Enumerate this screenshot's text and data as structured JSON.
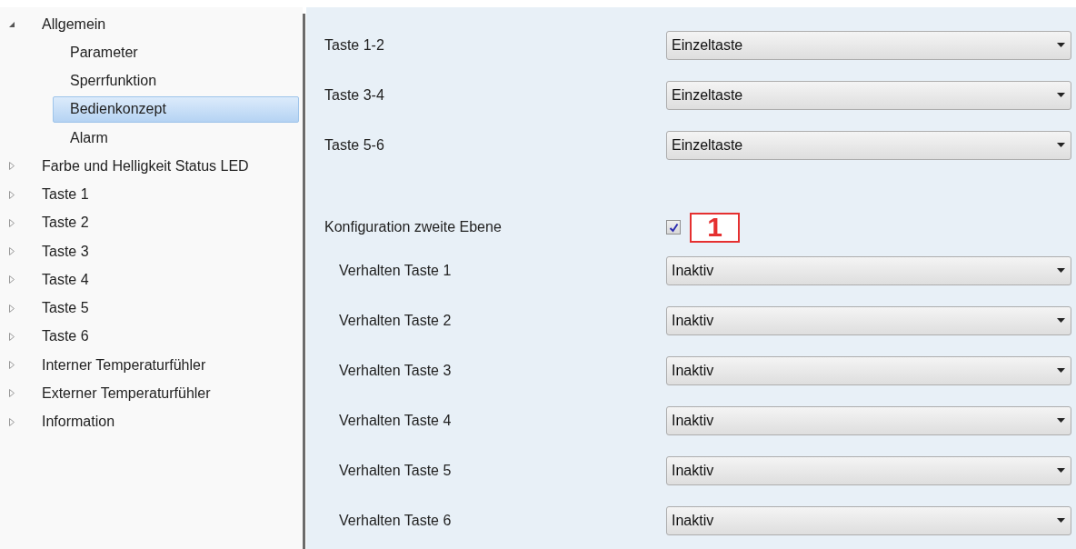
{
  "tree": [
    {
      "label": "Allgemein",
      "expanded": true,
      "selected": false,
      "children": [
        {
          "label": "Parameter",
          "selected": false
        },
        {
          "label": "Sperrfunktion",
          "selected": false
        },
        {
          "label": "Bedienkonzept",
          "selected": true
        },
        {
          "label": "Alarm",
          "selected": false
        }
      ]
    },
    {
      "label": "Farbe und Helligkeit Status LED",
      "expanded": false,
      "selected": false
    },
    {
      "label": "Taste 1",
      "expanded": false,
      "selected": false
    },
    {
      "label": "Taste 2",
      "expanded": false,
      "selected": false
    },
    {
      "label": "Taste 3",
      "expanded": false,
      "selected": false
    },
    {
      "label": "Taste 4",
      "expanded": false,
      "selected": false
    },
    {
      "label": "Taste 5",
      "expanded": false,
      "selected": false
    },
    {
      "label": "Taste 6",
      "expanded": false,
      "selected": false
    },
    {
      "label": "Interner Temperaturfühler",
      "expanded": false,
      "selected": false
    },
    {
      "label": "Externer Temperaturfühler",
      "expanded": false,
      "selected": false
    },
    {
      "label": "Information",
      "expanded": false,
      "selected": false
    }
  ],
  "settings": [
    {
      "label": "Taste 1-2",
      "value": "Einzeltaste"
    },
    {
      "label": "Taste 3-4",
      "value": "Einzeltaste"
    },
    {
      "label": "Taste 5-6",
      "value": "Einzeltaste"
    }
  ],
  "second_level": {
    "label": "Konfiguration zweite Ebene",
    "checked": true,
    "callout": "1",
    "rows": [
      {
        "label": "Verhalten Taste 1",
        "value": "Inaktiv"
      },
      {
        "label": "Verhalten Taste 2",
        "value": "Inaktiv"
      },
      {
        "label": "Verhalten Taste 3",
        "value": "Inaktiv"
      },
      {
        "label": "Verhalten Taste 4",
        "value": "Inaktiv"
      },
      {
        "label": "Verhalten Taste 5",
        "value": "Inaktiv"
      },
      {
        "label": "Verhalten Taste 6",
        "value": "Inaktiv"
      }
    ]
  }
}
